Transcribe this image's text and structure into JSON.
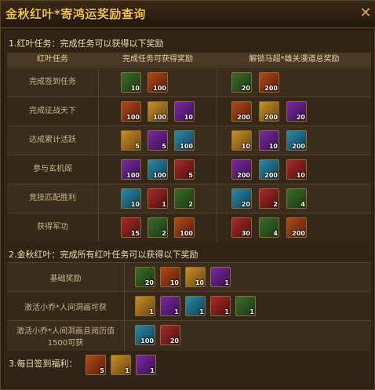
{
  "window": {
    "title": "金秋红叶*寄鸿运奖励查询"
  },
  "section1": {
    "title": "1.红叶任务：完成任务可以获得以下奖励",
    "headers": [
      "红叶任务",
      "完成任务可获得奖励",
      "解锁马超*雄关漫道总奖励"
    ],
    "rows": [
      {
        "label": "完成签到任务",
        "rewards": [
          "10",
          "100"
        ],
        "unlock": [
          "20",
          "200"
        ]
      },
      {
        "label": "完成征战天下",
        "rewards": [
          "100",
          "100",
          "10"
        ],
        "unlock": [
          "200",
          "200",
          "20"
        ]
      },
      {
        "label": "达成累计活跃",
        "rewards": [
          "5",
          "5",
          "100"
        ],
        "unlock": [
          "10",
          "10",
          "200"
        ]
      },
      {
        "label": "参与玄机阁",
        "rewards": [
          "100",
          "100",
          "5"
        ],
        "unlock": [
          "200",
          "200",
          "10"
        ]
      },
      {
        "label": "竞技匹配胜利",
        "rewards": [
          "10",
          "1",
          "2"
        ],
        "unlock": [
          "20",
          "2",
          "4"
        ]
      },
      {
        "label": "获得军功",
        "rewards": [
          "15",
          "2",
          "100"
        ],
        "unlock": [
          "30",
          "4",
          "200"
        ]
      }
    ]
  },
  "section2": {
    "title": "2.金秋红叶：完成所有红叶任务可以获得以下奖励",
    "rows": [
      {
        "label": "基础奖励",
        "rewards": [
          "20",
          "10",
          "10",
          "1"
        ]
      },
      {
        "label": "激活小乔*人间洞画可获",
        "rewards": [
          "1",
          "1",
          "1",
          "1",
          "1"
        ]
      },
      {
        "label": "激活小乔*人间洞画且阅历值1500可获",
        "rewards": [
          "100",
          "20"
        ]
      }
    ]
  },
  "section3": {
    "title": "3.每日签到福利：",
    "rewards": [
      "5",
      "1",
      "1"
    ]
  },
  "colors": {
    "title": "#f0c24a",
    "frame": "#8a6a35"
  }
}
